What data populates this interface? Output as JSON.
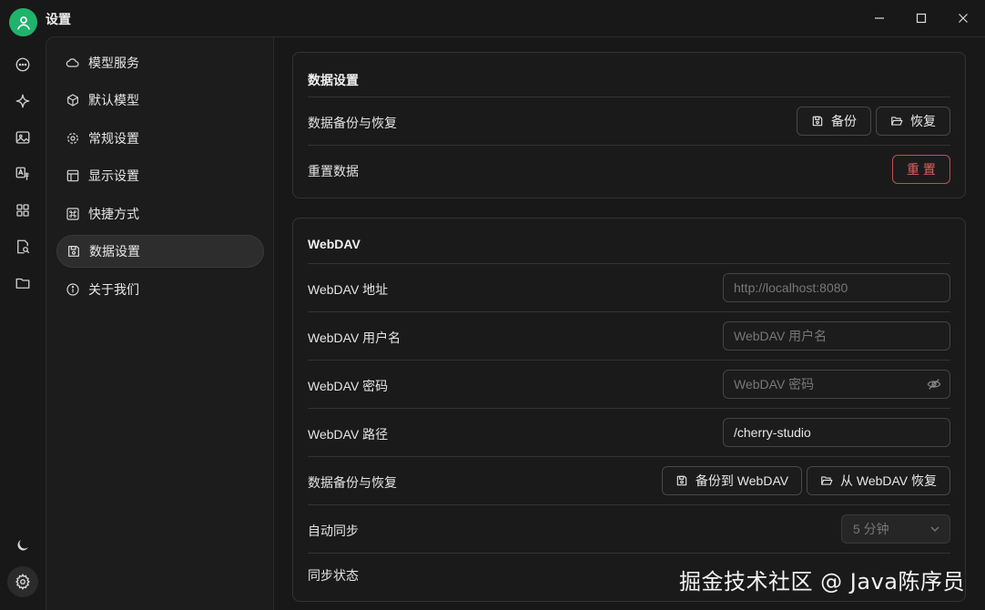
{
  "window": {
    "title": "设置"
  },
  "nav": {
    "items": [
      {
        "label": "模型服务",
        "icon": "cloud-icon"
      },
      {
        "label": "默认模型",
        "icon": "cube-icon"
      },
      {
        "label": "常规设置",
        "icon": "gear-icon"
      },
      {
        "label": "显示设置",
        "icon": "layout-icon"
      },
      {
        "label": "快捷方式",
        "icon": "command-icon"
      },
      {
        "label": "数据设置",
        "icon": "save-icon",
        "active": true
      },
      {
        "label": "关于我们",
        "icon": "info-icon"
      }
    ]
  },
  "data_settings": {
    "title": "数据设置",
    "backup_restore_label": "数据备份与恢复",
    "backup_button": "备份",
    "restore_button": "恢复",
    "reset_label": "重置数据",
    "reset_button": "重 置"
  },
  "webdav": {
    "title": "WebDAV",
    "address_label": "WebDAV 地址",
    "address_placeholder": "http://localhost:8080",
    "username_label": "WebDAV 用户名",
    "username_placeholder": "WebDAV 用户名",
    "password_label": "WebDAV 密码",
    "password_placeholder": "WebDAV 密码",
    "path_label": "WebDAV 路径",
    "path_value": "/cherry-studio",
    "backup_restore_label": "数据备份与恢复",
    "backup_button": "备份到 WebDAV",
    "restore_button": "从 WebDAV 恢复",
    "autosync_label": "自动同步",
    "autosync_value": "5 分钟",
    "sync_status_label": "同步状态"
  },
  "colors": {
    "accent": "#1fb36c",
    "danger": "#e0605c",
    "background": "#181818"
  },
  "watermark": "掘金技术社区 @ Java陈序员"
}
